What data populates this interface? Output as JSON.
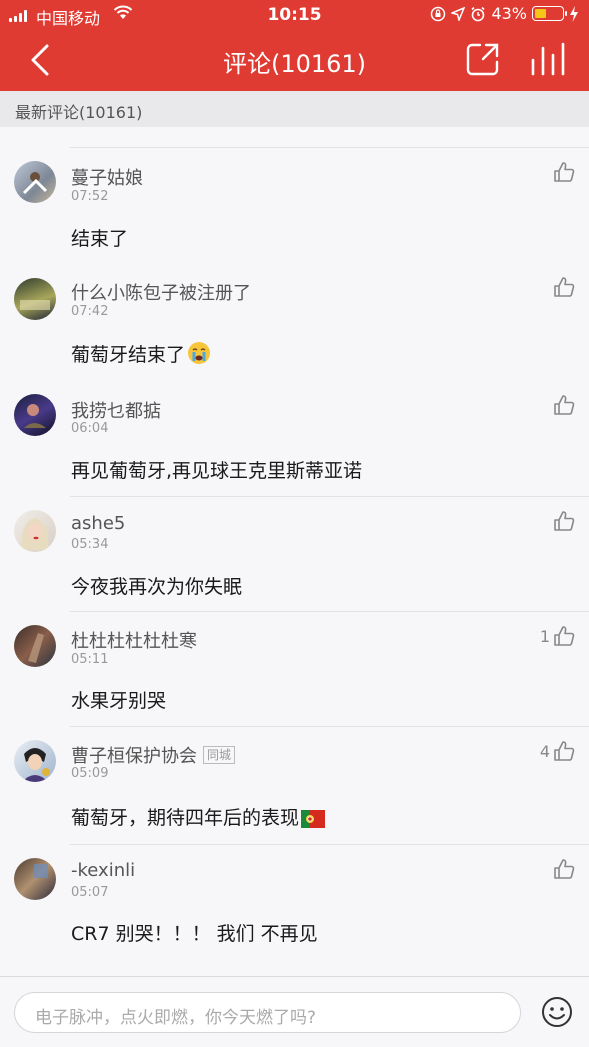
{
  "status_bar": {
    "carrier": "中国移动",
    "time": "10:15",
    "battery_percent": "43%",
    "battery_level": 0.43,
    "battery_color": "#f5c518"
  },
  "nav": {
    "title": "评论(10161)",
    "back_icon": "chevron-left-icon",
    "share_icon": "share-icon",
    "stats_icon": "bar-chart-icon",
    "bg_color": "#e03b33"
  },
  "section": {
    "label": "最新评论(10161)"
  },
  "comments": [
    {
      "user": "蔓子姑娘",
      "time": "07:52",
      "text": "结束了",
      "likes": "",
      "tag": ""
    },
    {
      "user": "什么小陈包子被注册了",
      "time": "07:42",
      "text": "葡萄牙结束了",
      "likes": "",
      "tag": "",
      "emoji": "crying-face-icon"
    },
    {
      "user": "我捞乜都掂",
      "time": "06:04",
      "text": "再见葡萄牙,再见球王克里斯蒂亚诺",
      "likes": "",
      "tag": ""
    },
    {
      "user": "ashe5",
      "time": "05:34",
      "text": "今夜我再次为你失眠",
      "likes": "",
      "tag": ""
    },
    {
      "user": "杜杜杜杜杜杜寒",
      "time": "05:11",
      "text": "水果牙别哭",
      "likes": "1",
      "tag": ""
    },
    {
      "user": "曹子桓保护协会",
      "time": "05:09",
      "text": "葡萄牙，期待四年后的表现",
      "likes": "4",
      "tag": "同城",
      "emoji": "portugal-flag-icon"
    },
    {
      "user": "-kexinli",
      "time": "05:07",
      "text": "CR7 别哭！！！ 我们 不再见",
      "likes": "",
      "tag": ""
    }
  ],
  "input": {
    "placeholder": "电子脉冲，点火即燃，你今天燃了吗?",
    "emoji_icon": "smiley-icon"
  }
}
